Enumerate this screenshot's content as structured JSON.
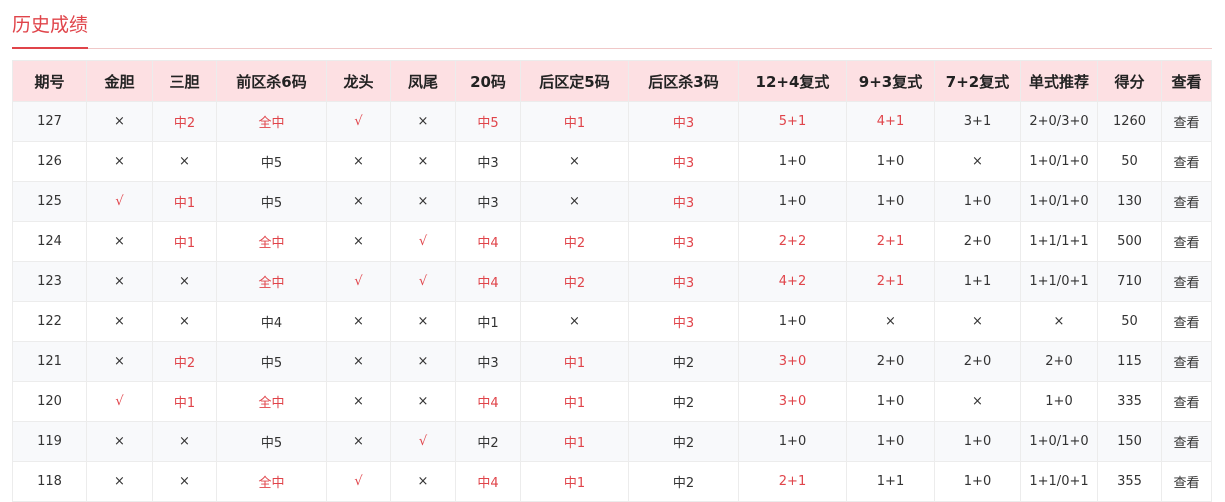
{
  "page": {
    "title": "历史成绩"
  },
  "colors": {
    "accent": "#e0444a",
    "header_bg": "#fde0e3",
    "row_alt_bg": "#f8f9fb",
    "text": "#333333"
  },
  "table": {
    "columns": [
      "期号",
      "金胆",
      "三胆",
      "前区杀6码",
      "龙头",
      "凤尾",
      "20码",
      "后区定5码",
      "后区杀3码",
      "12+4复式",
      "9+3复式",
      "7+2复式",
      "单式推荐",
      "得分",
      "查看"
    ],
    "rows": [
      {
        "period": "127",
        "cells": [
          {
            "v": "×",
            "hit": false
          },
          {
            "v": "中2",
            "hit": true
          },
          {
            "v": "全中",
            "hit": true
          },
          {
            "v": "√",
            "hit": true
          },
          {
            "v": "×",
            "hit": false
          },
          {
            "v": "中5",
            "hit": true
          },
          {
            "v": "中1",
            "hit": true
          },
          {
            "v": "中3",
            "hit": true
          },
          {
            "v": "5+1",
            "hit": true
          },
          {
            "v": "4+1",
            "hit": true
          },
          {
            "v": "3+1",
            "hit": false
          },
          {
            "v": "2+0/3+0",
            "hit": false
          }
        ],
        "score": "1260",
        "view": "查看"
      },
      {
        "period": "126",
        "cells": [
          {
            "v": "×",
            "hit": false
          },
          {
            "v": "×",
            "hit": false
          },
          {
            "v": "中5",
            "hit": false
          },
          {
            "v": "×",
            "hit": false
          },
          {
            "v": "×",
            "hit": false
          },
          {
            "v": "中3",
            "hit": false
          },
          {
            "v": "×",
            "hit": false
          },
          {
            "v": "中3",
            "hit": true
          },
          {
            "v": "1+0",
            "hit": false
          },
          {
            "v": "1+0",
            "hit": false
          },
          {
            "v": "×",
            "hit": false
          },
          {
            "v": "1+0/1+0",
            "hit": false
          }
        ],
        "score": "50",
        "view": "查看"
      },
      {
        "period": "125",
        "cells": [
          {
            "v": "√",
            "hit": true
          },
          {
            "v": "中1",
            "hit": true
          },
          {
            "v": "中5",
            "hit": false
          },
          {
            "v": "×",
            "hit": false
          },
          {
            "v": "×",
            "hit": false
          },
          {
            "v": "中3",
            "hit": false
          },
          {
            "v": "×",
            "hit": false
          },
          {
            "v": "中3",
            "hit": true
          },
          {
            "v": "1+0",
            "hit": false
          },
          {
            "v": "1+0",
            "hit": false
          },
          {
            "v": "1+0",
            "hit": false
          },
          {
            "v": "1+0/1+0",
            "hit": false
          }
        ],
        "score": "130",
        "view": "查看"
      },
      {
        "period": "124",
        "cells": [
          {
            "v": "×",
            "hit": false
          },
          {
            "v": "中1",
            "hit": true
          },
          {
            "v": "全中",
            "hit": true
          },
          {
            "v": "×",
            "hit": false
          },
          {
            "v": "√",
            "hit": true
          },
          {
            "v": "中4",
            "hit": true
          },
          {
            "v": "中2",
            "hit": true
          },
          {
            "v": "中3",
            "hit": true
          },
          {
            "v": "2+2",
            "hit": true
          },
          {
            "v": "2+1",
            "hit": true
          },
          {
            "v": "2+0",
            "hit": false
          },
          {
            "v": "1+1/1+1",
            "hit": false
          }
        ],
        "score": "500",
        "view": "查看"
      },
      {
        "period": "123",
        "cells": [
          {
            "v": "×",
            "hit": false
          },
          {
            "v": "×",
            "hit": false
          },
          {
            "v": "全中",
            "hit": true
          },
          {
            "v": "√",
            "hit": true
          },
          {
            "v": "√",
            "hit": true
          },
          {
            "v": "中4",
            "hit": true
          },
          {
            "v": "中2",
            "hit": true
          },
          {
            "v": "中3",
            "hit": true
          },
          {
            "v": "4+2",
            "hit": true
          },
          {
            "v": "2+1",
            "hit": true
          },
          {
            "v": "1+1",
            "hit": false
          },
          {
            "v": "1+1/0+1",
            "hit": false
          }
        ],
        "score": "710",
        "view": "查看"
      },
      {
        "period": "122",
        "cells": [
          {
            "v": "×",
            "hit": false
          },
          {
            "v": "×",
            "hit": false
          },
          {
            "v": "中4",
            "hit": false
          },
          {
            "v": "×",
            "hit": false
          },
          {
            "v": "×",
            "hit": false
          },
          {
            "v": "中1",
            "hit": false
          },
          {
            "v": "×",
            "hit": false
          },
          {
            "v": "中3",
            "hit": true
          },
          {
            "v": "1+0",
            "hit": false
          },
          {
            "v": "×",
            "hit": false
          },
          {
            "v": "×",
            "hit": false
          },
          {
            "v": "×",
            "hit": false
          }
        ],
        "score": "50",
        "view": "查看"
      },
      {
        "period": "121",
        "cells": [
          {
            "v": "×",
            "hit": false
          },
          {
            "v": "中2",
            "hit": true
          },
          {
            "v": "中5",
            "hit": false
          },
          {
            "v": "×",
            "hit": false
          },
          {
            "v": "×",
            "hit": false
          },
          {
            "v": "中3",
            "hit": false
          },
          {
            "v": "中1",
            "hit": true
          },
          {
            "v": "中2",
            "hit": false
          },
          {
            "v": "3+0",
            "hit": true
          },
          {
            "v": "2+0",
            "hit": false
          },
          {
            "v": "2+0",
            "hit": false
          },
          {
            "v": "2+0",
            "hit": false
          }
        ],
        "score": "115",
        "view": "查看"
      },
      {
        "period": "120",
        "cells": [
          {
            "v": "√",
            "hit": true
          },
          {
            "v": "中1",
            "hit": true
          },
          {
            "v": "全中",
            "hit": true
          },
          {
            "v": "×",
            "hit": false
          },
          {
            "v": "×",
            "hit": false
          },
          {
            "v": "中4",
            "hit": true
          },
          {
            "v": "中1",
            "hit": true
          },
          {
            "v": "中2",
            "hit": false
          },
          {
            "v": "3+0",
            "hit": true
          },
          {
            "v": "1+0",
            "hit": false
          },
          {
            "v": "×",
            "hit": false
          },
          {
            "v": "1+0",
            "hit": false
          }
        ],
        "score": "335",
        "view": "查看"
      },
      {
        "period": "119",
        "cells": [
          {
            "v": "×",
            "hit": false
          },
          {
            "v": "×",
            "hit": false
          },
          {
            "v": "中5",
            "hit": false
          },
          {
            "v": "×",
            "hit": false
          },
          {
            "v": "√",
            "hit": true
          },
          {
            "v": "中2",
            "hit": false
          },
          {
            "v": "中1",
            "hit": true
          },
          {
            "v": "中2",
            "hit": false
          },
          {
            "v": "1+0",
            "hit": false
          },
          {
            "v": "1+0",
            "hit": false
          },
          {
            "v": "1+0",
            "hit": false
          },
          {
            "v": "1+0/1+0",
            "hit": false
          }
        ],
        "score": "150",
        "view": "查看"
      },
      {
        "period": "118",
        "cells": [
          {
            "v": "×",
            "hit": false
          },
          {
            "v": "×",
            "hit": false
          },
          {
            "v": "全中",
            "hit": true
          },
          {
            "v": "√",
            "hit": true
          },
          {
            "v": "×",
            "hit": false
          },
          {
            "v": "中4",
            "hit": true
          },
          {
            "v": "中1",
            "hit": true
          },
          {
            "v": "中2",
            "hit": false
          },
          {
            "v": "2+1",
            "hit": true
          },
          {
            "v": "1+1",
            "hit": false
          },
          {
            "v": "1+0",
            "hit": false
          },
          {
            "v": "1+1/0+1",
            "hit": false
          }
        ],
        "score": "355",
        "view": "查看"
      }
    ]
  }
}
